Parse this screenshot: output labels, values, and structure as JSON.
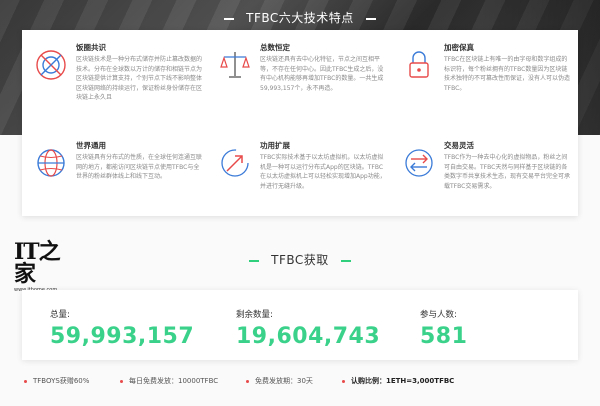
{
  "header": {
    "title": "TFBC六大技术特点"
  },
  "features": [
    {
      "title": "饭圈共识",
      "icon": "target-icon",
      "desc": "区块链技术是一种分布式储存并防止篡改数据的技术。分布在全球数以万计的储存和相链节点为区块链提供计算支持，个别节点下线不影响整体区块链网络的持续运行，保证粉丝身份储存在区块链上永久且"
    },
    {
      "title": "总数恒定",
      "icon": "balance-scale-icon",
      "desc": "区块链还具有去中心化特征，节点之间互相平等，不存在任何中心。因此TFBC生成之后，没有中心机构能够再增加TFBC的数量。一共生成59,993,157个，永不再造。"
    },
    {
      "title": "加密保真",
      "icon": "lock-icon",
      "desc": "TFBC在区块链上有唯一的由字母和数字组成的标识符，每个粉丝拥有的TFBC数量因为区块链技术独特的不可篡改性而保证，没有人可以伪造TFBC。"
    },
    {
      "title": "世界通用",
      "icon": "globe-icon",
      "desc": "区块链具有分布式的性质，在全球任何连通互联网的地方，都能访问区块链节点使用TFBC与全世界的粉丝群体线上和线下互动。"
    },
    {
      "title": "功用扩展",
      "icon": "trend-arrow-icon",
      "desc": "TFBC实际技术基于以太坊虚拟机，以太坊虚拟机是一种可以运行分布式App的区块链。TFBC在以太坊虚拟机上可以轻松实现增加App功能，并进行无缝升级。"
    },
    {
      "title": "交易灵活",
      "icon": "exchange-arrows-icon",
      "desc": "TFBC作为一种去中心化的虚拟物品，粉丝之间可自由交易。TFBC天然与同样基于区块链的各类数字币共享技术生态，现有交易平台完全可承载TFBC交易需求。"
    }
  ],
  "logo": {
    "mark": "IT之家",
    "url": "www.ithome.com"
  },
  "acquire": {
    "title": "TFBC获取"
  },
  "stats": [
    {
      "label": "总量:",
      "value": "59,993,157"
    },
    {
      "label": "剩余数量:",
      "value": "19,604,743"
    },
    {
      "label": "参与人数:",
      "value": "581"
    }
  ],
  "bullets": [
    {
      "text": "TFBOYS获赠60%"
    },
    {
      "text": "每日免费发放：10000TFBC"
    },
    {
      "text": "免费发放期：30天"
    },
    {
      "text": "认购比例：1ETH=3,000TFBC"
    }
  ],
  "colors": {
    "accent": "#3ad28a",
    "bullet_dot": "#e84a4a",
    "icon_red": "#e84a4a",
    "icon_blue": "#3b7bd8"
  }
}
